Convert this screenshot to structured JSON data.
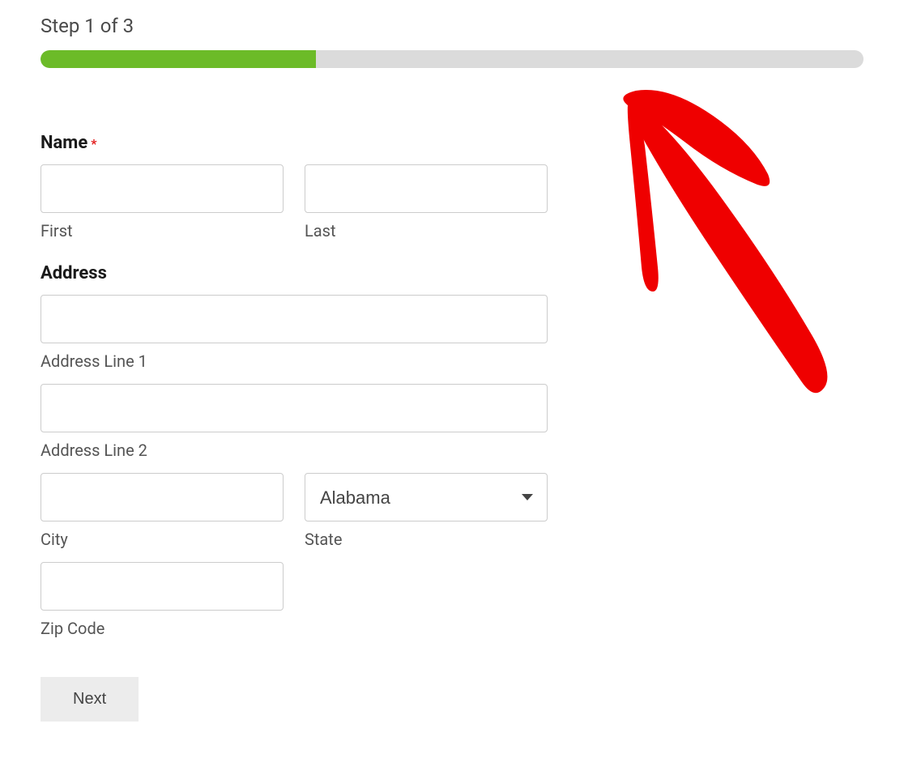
{
  "progress": {
    "label": "Step 1 of 3",
    "percent": 33.5
  },
  "name": {
    "group_label": "Name",
    "required_mark": "*",
    "first_label": "First",
    "last_label": "Last",
    "first_value": "",
    "last_value": ""
  },
  "address": {
    "group_label": "Address",
    "line1_label": "Address Line 1",
    "line2_label": "Address Line 2",
    "city_label": "City",
    "state_label": "State",
    "zip_label": "Zip Code",
    "line1_value": "",
    "line2_value": "",
    "city_value": "",
    "state_value": "Alabama",
    "zip_value": ""
  },
  "buttons": {
    "next_label": "Next"
  }
}
